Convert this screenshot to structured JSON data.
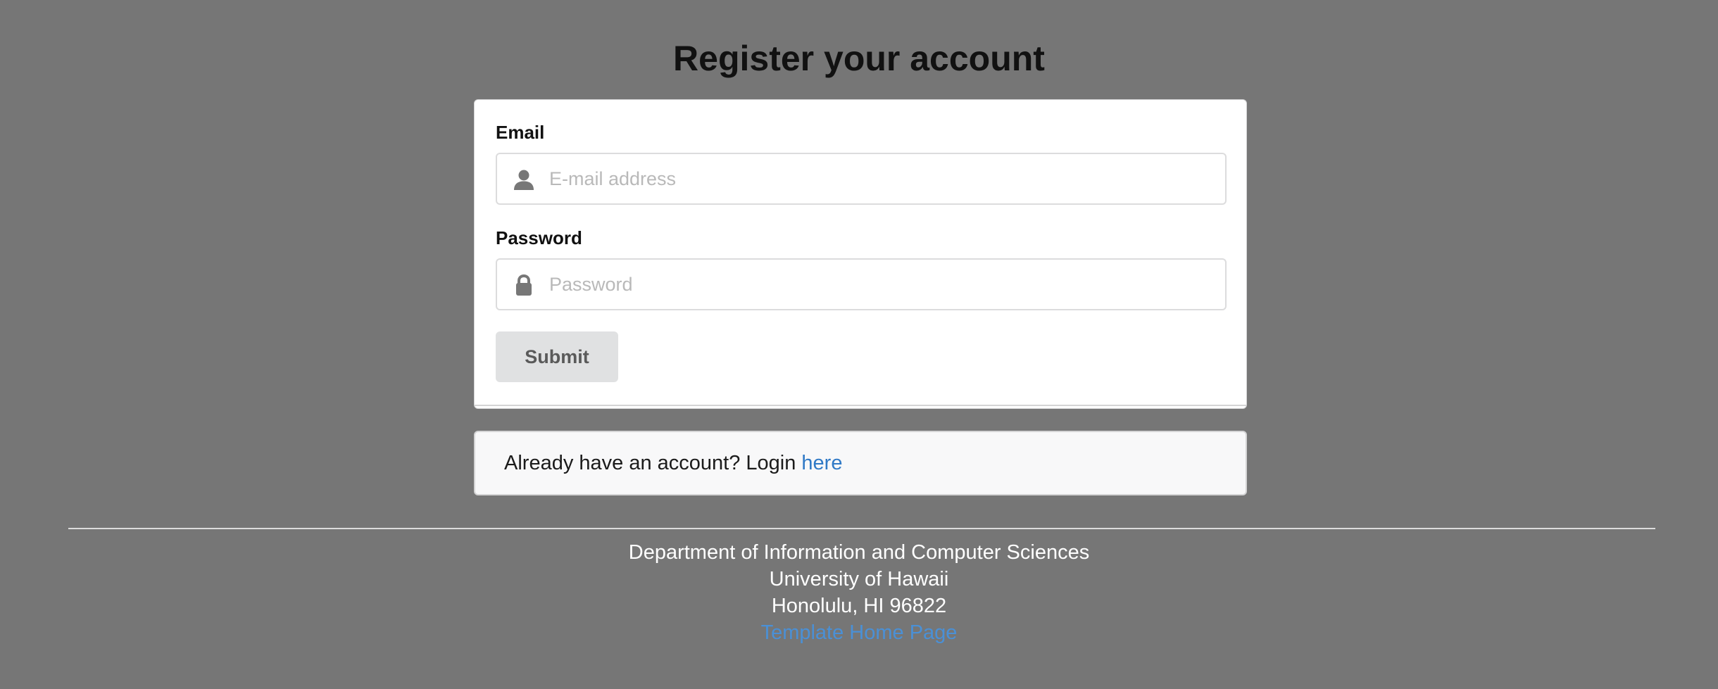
{
  "page": {
    "title": "Register your account"
  },
  "form": {
    "email": {
      "label": "Email",
      "placeholder": "E-mail address",
      "icon": "user-icon"
    },
    "password": {
      "label": "Password",
      "placeholder": "Password",
      "icon": "lock-icon"
    },
    "submit_label": "Submit"
  },
  "login_message": {
    "text": "Already have an account? Login ",
    "link_text": "here"
  },
  "footer": {
    "line1": "Department of Information and Computer Sciences",
    "line2": "University of Hawaii",
    "line3": "Honolulu, HI 96822",
    "link_text": "Template Home Page"
  },
  "colors": {
    "background": "#767676",
    "card": "#ffffff",
    "link": "#2f79c6",
    "button": "#e0e1e2"
  }
}
